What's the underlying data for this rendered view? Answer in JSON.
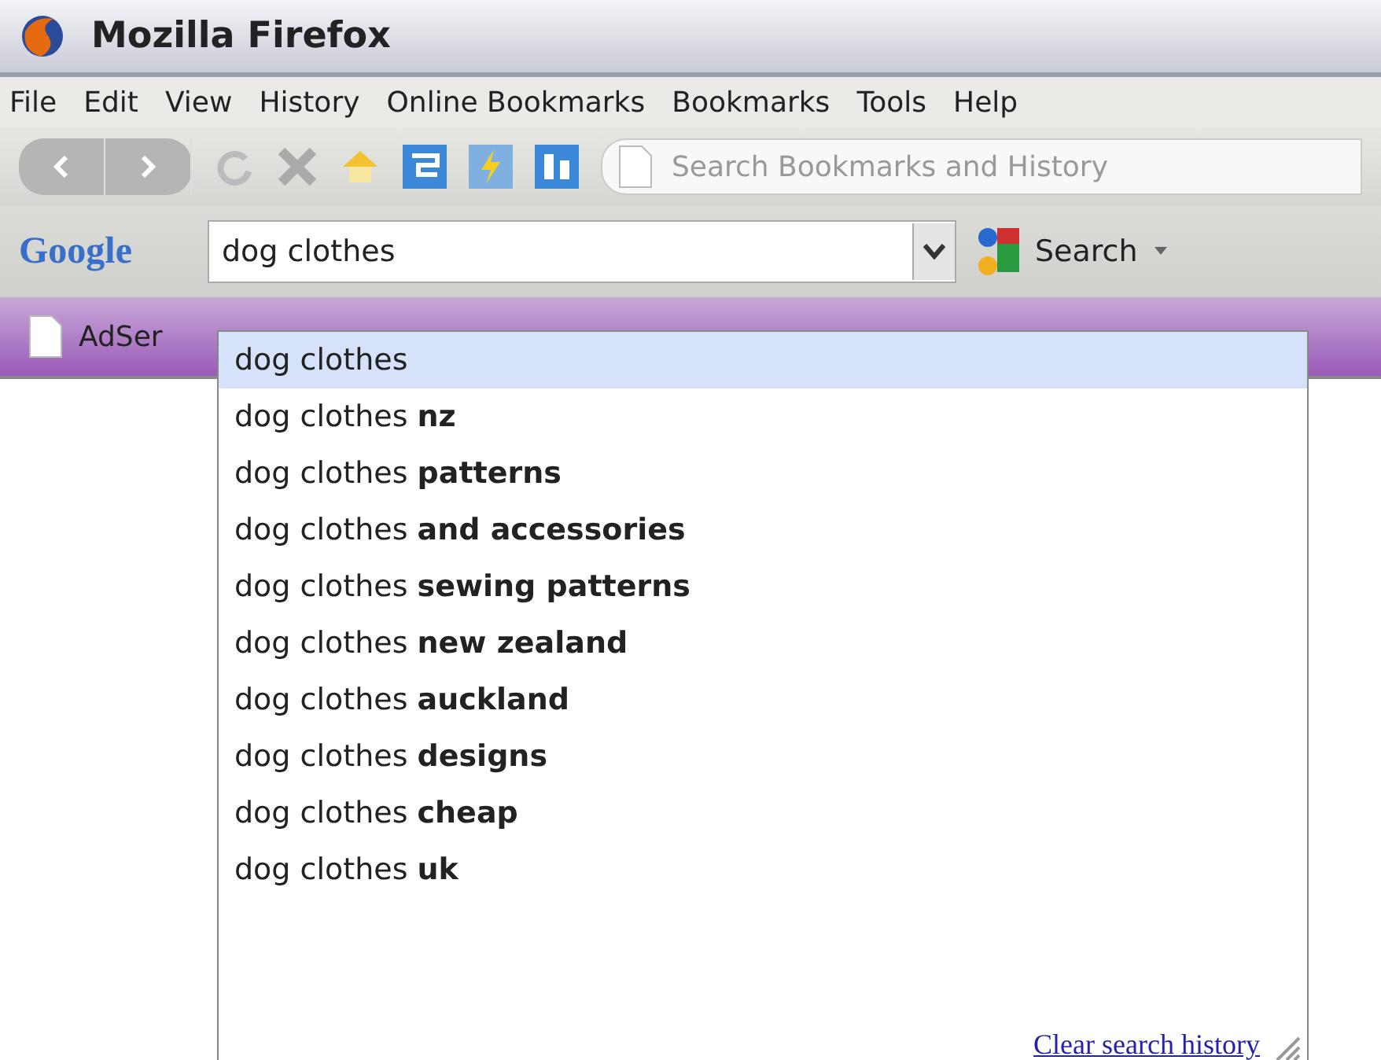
{
  "window": {
    "title": "Mozilla Firefox"
  },
  "menu": [
    "File",
    "Edit",
    "View",
    "History",
    "Online Bookmarks",
    "Bookmarks",
    "Tools",
    "Help"
  ],
  "bookmark_search": {
    "placeholder": "Search Bookmarks and History"
  },
  "google_toolbar": {
    "logo": "Google",
    "query": "dog clothes",
    "search_button": "Search"
  },
  "bookmarks_bar": [
    {
      "label": "AdSer"
    }
  ],
  "suggestions": [
    {
      "text": "dog clothes",
      "selected": true
    },
    {
      "text": "dog clothes **nz**",
      "selected": false
    },
    {
      "text": "dog clothes **patterns**",
      "selected": false
    },
    {
      "text": "dog clothes **and accessories**",
      "selected": false
    },
    {
      "text": "dog clothes **sewing patterns**",
      "selected": false
    },
    {
      "text": "dog clothes **new zealand**",
      "selected": false
    },
    {
      "text": "dog clothes **auckland**",
      "selected": false
    },
    {
      "text": "dog clothes **designs**",
      "selected": false
    },
    {
      "text": "dog clothes **cheap**",
      "selected": false
    },
    {
      "text": "dog clothes **uk**",
      "selected": false
    }
  ],
  "clear_history": "Clear search history"
}
